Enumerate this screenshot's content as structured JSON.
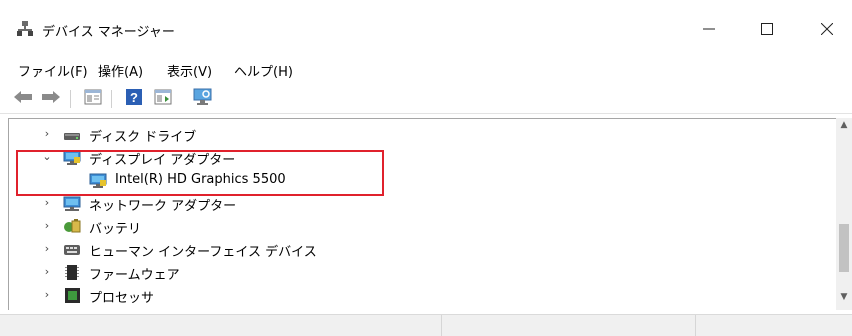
{
  "window": {
    "title": "デバイス マネージャー",
    "minimize_glyph": "—",
    "maximize_glyph": "☐",
    "close_glyph": "✕"
  },
  "menu": [
    {
      "label": "ファイル(F)"
    },
    {
      "label": "操作(A)"
    },
    {
      "label": "表示(V)"
    },
    {
      "label": "ヘルプ(H)"
    }
  ],
  "toolbar": {
    "icons": [
      "back-arrow-icon",
      "forward-arrow-icon",
      "properties-icon",
      "help-icon",
      "show-hide-icon",
      "scan-hardware-icon"
    ]
  },
  "tree": {
    "rows": [
      {
        "label": "ディスク ドライブ",
        "expanded": false,
        "icon": "disk-drive-icon"
      },
      {
        "label": "ディスプレイ アダプター",
        "expanded": true,
        "icon": "display-adapter-icon"
      },
      {
        "label": "Intel(R) HD Graphics 5500",
        "child": true,
        "icon": "display-adapter-icon"
      },
      {
        "label": "ネットワーク アダプター",
        "expanded": false,
        "icon": "network-adapter-icon"
      },
      {
        "label": "バッテリ",
        "expanded": false,
        "icon": "battery-icon"
      },
      {
        "label": "ヒューマン インターフェイス デバイス",
        "expanded": false,
        "icon": "hid-icon"
      },
      {
        "label": "ファームウェア",
        "expanded": false,
        "icon": "firmware-icon"
      },
      {
        "label": "プロセッサ",
        "expanded": false,
        "icon": "processor-icon"
      }
    ]
  },
  "colors": {
    "highlight_border": "#e0212c",
    "pane_border": "#a6a6a6"
  }
}
